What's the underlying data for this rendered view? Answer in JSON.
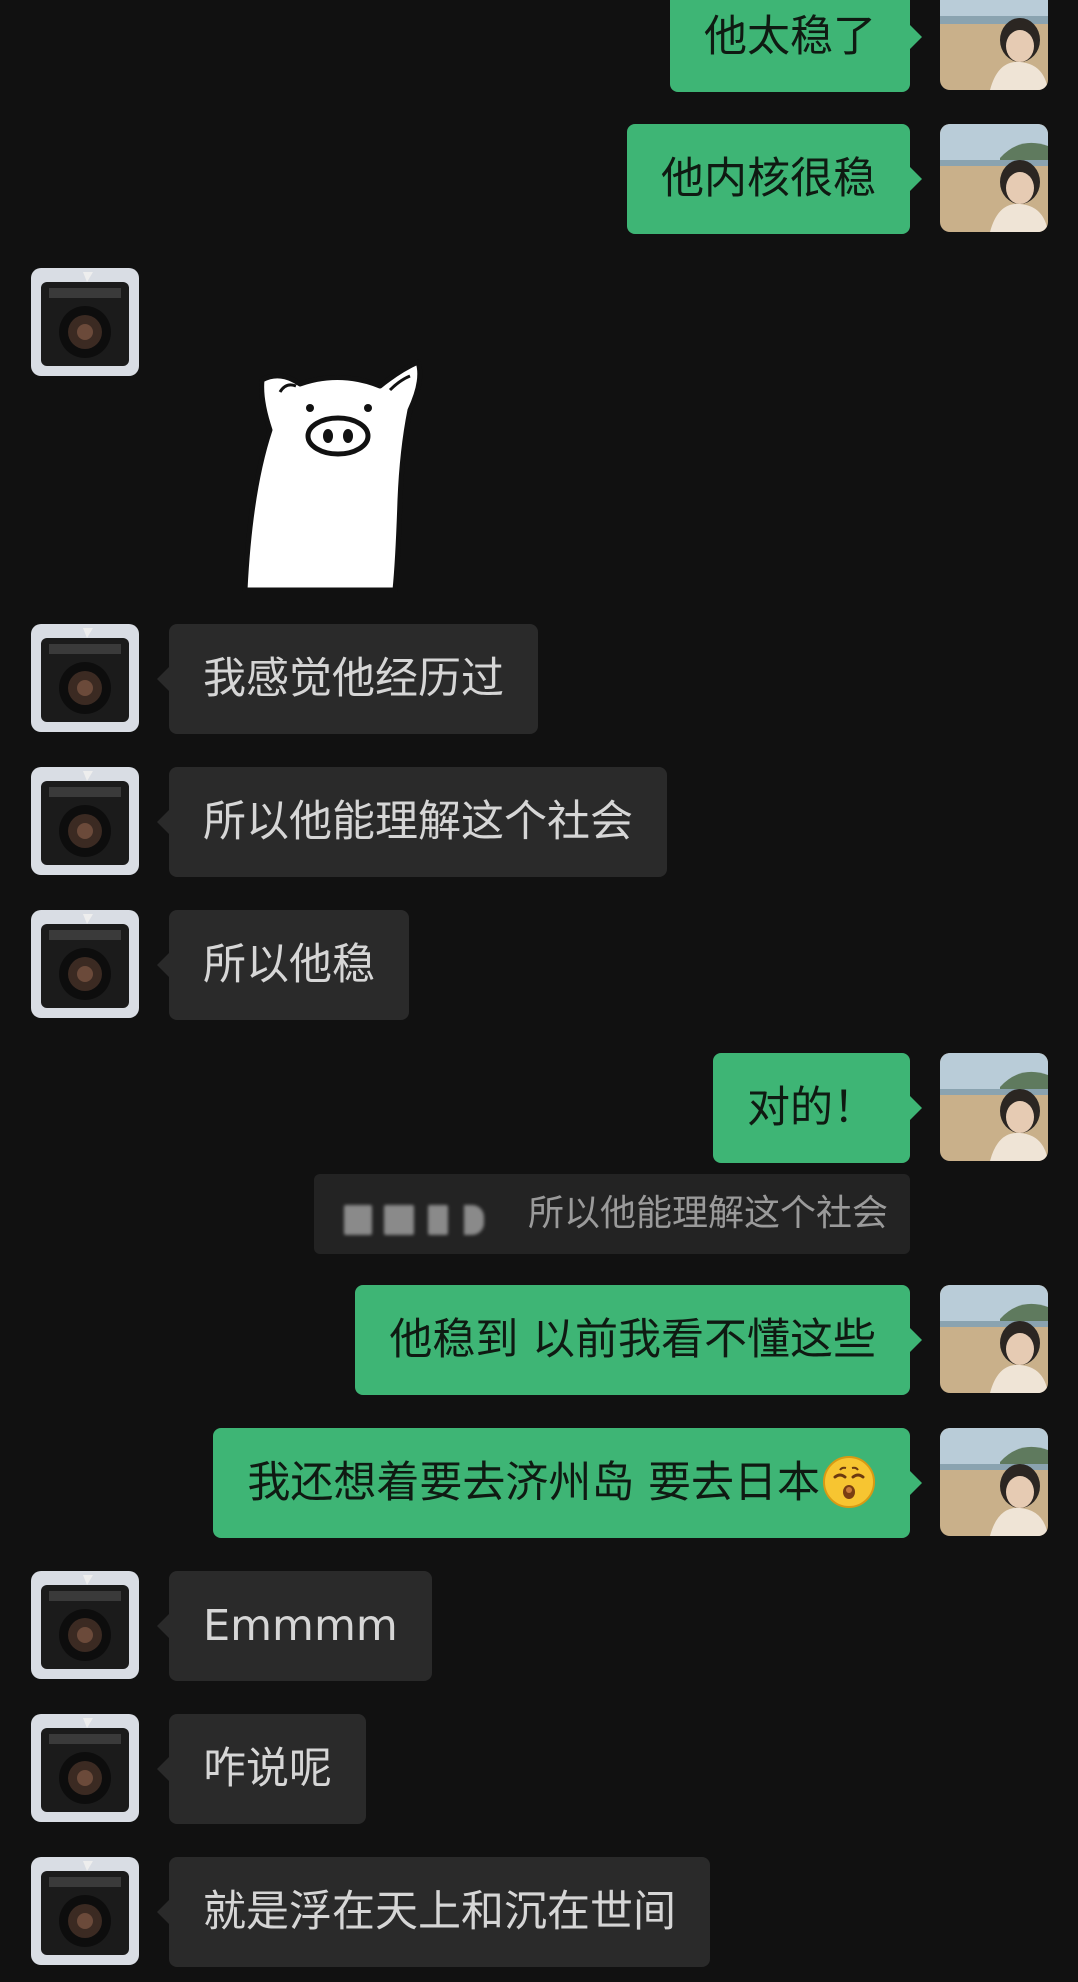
{
  "messages": [
    {
      "side": "out",
      "text": "他太稳了"
    },
    {
      "side": "out",
      "text": "他内核很稳"
    },
    {
      "side": "in",
      "type": "sticker",
      "sticker": "pig-sticker"
    },
    {
      "side": "in",
      "text": "我感觉他经历过"
    },
    {
      "side": "in",
      "text": "所以他能理解这个社会"
    },
    {
      "side": "in",
      "text": "所以他稳"
    },
    {
      "side": "out",
      "text": "对的！"
    },
    {
      "type": "quote",
      "quoted_text": "所以他能理解这个社会"
    },
    {
      "side": "out",
      "text": "他稳到 以前我看不懂这些"
    },
    {
      "side": "out",
      "text": "我还想着要去济州岛 要去日本",
      "emoji": "kissing-face-emoji"
    },
    {
      "side": "in",
      "text": "Emmmm"
    },
    {
      "side": "in",
      "text": "咋说呢"
    },
    {
      "side": "in",
      "text": "就是浮在天上和沉在世间"
    }
  ],
  "avatars": {
    "self": "beach-portrait-avatar",
    "contact": "camera-avatar"
  },
  "colors": {
    "background": "#111111",
    "outgoing_bubble": "#3EB575",
    "incoming_bubble": "#2A2A2A",
    "incoming_text": "#D6D6D6",
    "quote_background": "#232323",
    "quote_text": "#9A9A9A"
  }
}
